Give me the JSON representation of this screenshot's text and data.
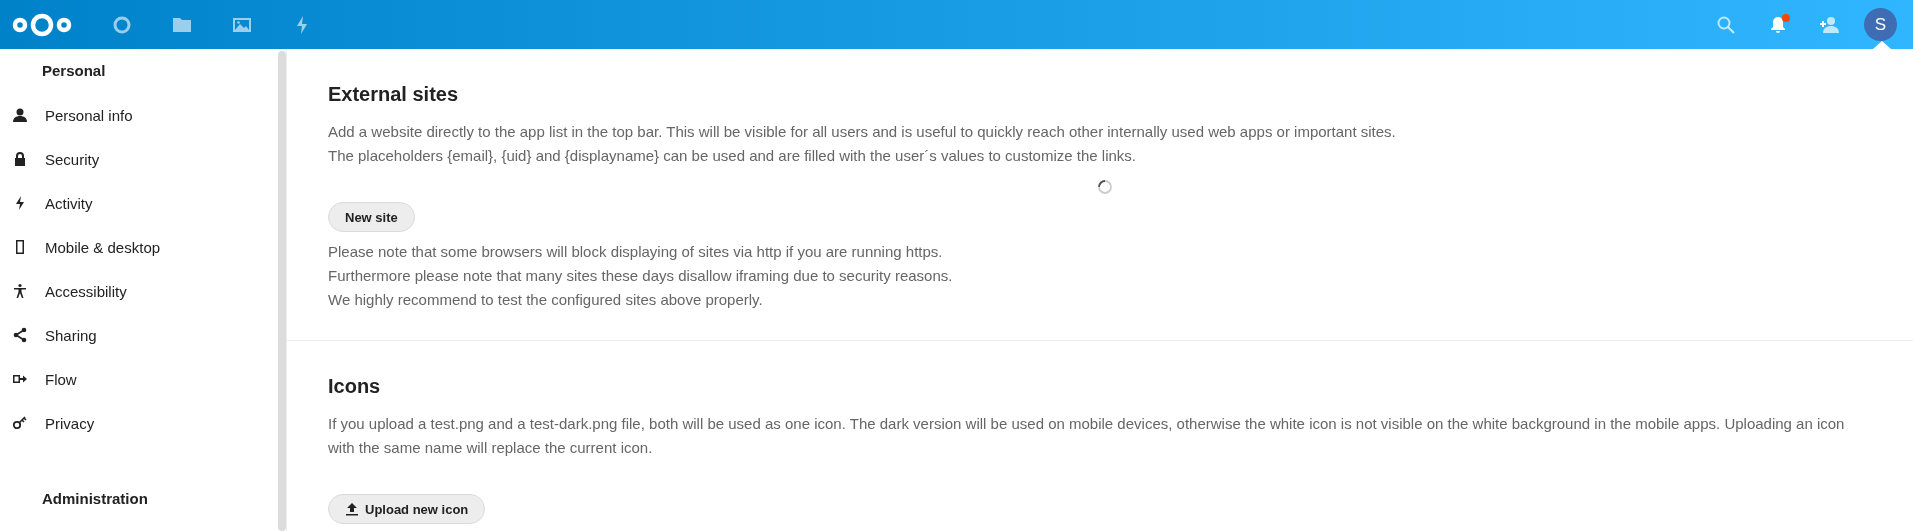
{
  "header": {
    "notifications": {
      "unread": true
    },
    "avatar": {
      "initial": "S"
    }
  },
  "sidebar": {
    "sections": [
      {
        "title": "Personal",
        "items": [
          {
            "label": "Personal info"
          },
          {
            "label": "Security"
          },
          {
            "label": "Activity"
          },
          {
            "label": "Mobile & desktop"
          },
          {
            "label": "Accessibility"
          },
          {
            "label": "Sharing"
          },
          {
            "label": "Flow"
          },
          {
            "label": "Privacy"
          }
        ]
      },
      {
        "title": "Administration"
      }
    ]
  },
  "sections": [
    {
      "title": "External sites",
      "loading": true,
      "paragraphs": [
        "Add a website directly to the app list in the top bar. This will be visible for all users and is useful to quickly reach other internally used web apps or important sites.",
        "The placeholders {email}, {uid} and {displayname} can be used and are filled with the user´s values to customize the links."
      ],
      "button": {
        "label": "New site",
        "kind": "plain"
      },
      "notes": [
        "Please note that some browsers will block displaying of sites via http if you are running https.",
        "Furthermore please note that many sites these days disallow iframing due to security reasons.",
        "We highly recommend to test the configured sites above properly."
      ]
    },
    {
      "title": "Icons",
      "paragraphs": [
        "If you upload a test.png and a test-dark.png file, both will be used as one icon. The dark version will be used on mobile devices, otherwise the white icon is not visible on the white background in the mobile apps. Uploading an icon with the same name will replace the current icon."
      ],
      "button": {
        "label": "Upload new icon",
        "kind": "upload"
      }
    }
  ]
}
